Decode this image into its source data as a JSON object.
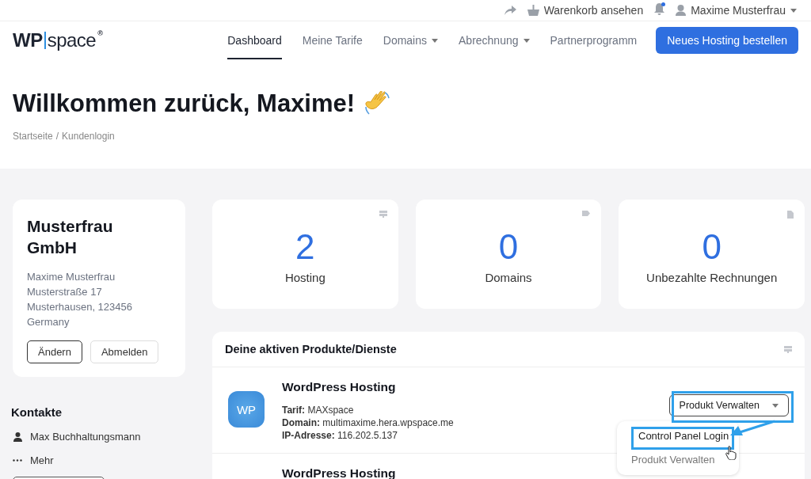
{
  "top_bar": {
    "cart_label": "Warenkorb ansehen",
    "notification_unread": true,
    "user_name": "Maxime Musterfrau"
  },
  "logo": {
    "left": "WP",
    "right": "space",
    "mark": "®"
  },
  "nav": [
    {
      "label": "Dashboard",
      "selected": true,
      "dropdown": false
    },
    {
      "label": "Meine Tarife",
      "selected": false,
      "dropdown": false
    },
    {
      "label": "Domains",
      "selected": false,
      "dropdown": true
    },
    {
      "label": "Abrechnung",
      "selected": false,
      "dropdown": true
    },
    {
      "label": "Partnerprogramm",
      "selected": false,
      "dropdown": false
    }
  ],
  "cta": "Neues Hosting bestellen",
  "hero": {
    "title": "Willkommen zurück, Maxime!",
    "breadcrumb": [
      "Startseite",
      "Kundenlogin"
    ],
    "separator": "/"
  },
  "account": {
    "name": "Musterfrau GmbH",
    "address": [
      "Maxime Musterfrau",
      "Musterstraße 17",
      "Musterhausen, 123456",
      "Germany"
    ],
    "buttons": [
      {
        "label": "Ändern",
        "kind": "primary"
      },
      {
        "label": "Abmelden",
        "kind": "secondary"
      }
    ]
  },
  "contacts": {
    "title": "Kontakte",
    "items": [
      {
        "kind": "person",
        "label": "Max Buchhaltungsmann"
      },
      {
        "kind": "more",
        "label": "Mehr"
      }
    ]
  },
  "stats": [
    {
      "value": "2",
      "label": "Hosting",
      "kind": "server"
    },
    {
      "value": "0",
      "label": "Domains",
      "kind": "tag"
    },
    {
      "value": "0",
      "label": "Unbezahlte Rechnungen",
      "kind": "document"
    }
  ],
  "products": {
    "title": "Deine aktiven Produkte/Dienste",
    "rows": [
      {
        "name": "WordPress Hosting",
        "details": [
          "**Tarif:** MAXspace",
          "**Domain:** multimaxime.hera.wpspace.me",
          "**IP-Adresse:** 116.202.5.137"
        ],
        "action": "Produkt Verwalten",
        "logo_text": "WP"
      },
      {
        "name": "WordPress Hosting"
      }
    ]
  },
  "dropdown": [
    {
      "label": "Control Panel Login",
      "highlighted": true
    },
    {
      "label": "Produkt Verwalten",
      "highlighted": false
    }
  ]
}
